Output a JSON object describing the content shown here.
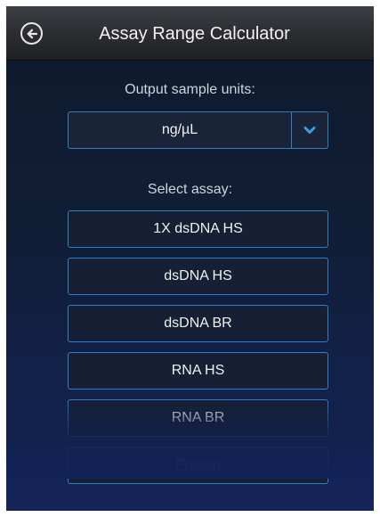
{
  "header": {
    "title": "Assay Range Calculator",
    "back_icon": "back-arrow-circle-icon"
  },
  "output_units": {
    "label": "Output sample units:",
    "selected": "ng/µL",
    "chevron_icon": "chevron-down-icon"
  },
  "assay": {
    "label": "Select assay:",
    "items": [
      {
        "label": "1X dsDNA HS"
      },
      {
        "label": "dsDNA HS"
      },
      {
        "label": "dsDNA BR"
      },
      {
        "label": "RNA HS"
      },
      {
        "label": "RNA BR"
      },
      {
        "label": "Protein"
      }
    ]
  },
  "colors": {
    "accent": "#2f7fc2",
    "background_top": "#0e1a2b",
    "background_bottom": "#15245a"
  }
}
